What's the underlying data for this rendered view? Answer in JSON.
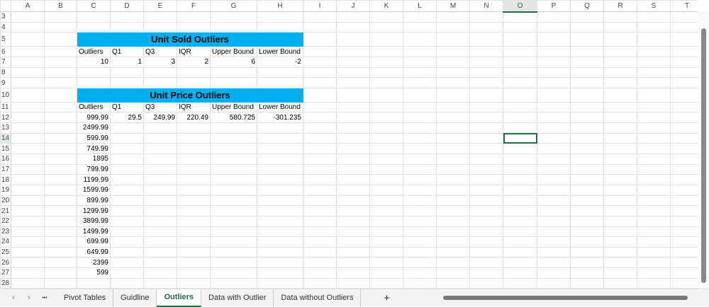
{
  "columns": [
    "A",
    "B",
    "C",
    "D",
    "E",
    "F",
    "G",
    "H",
    "I",
    "J",
    "K",
    "L",
    "M",
    "N",
    "O",
    "P",
    "Q",
    "R",
    "S",
    "T"
  ],
  "selected_cell": "O14",
  "unit_sold": {
    "title": "Unit Sold Outliers",
    "headers": [
      "Outliers",
      "Q1",
      "Q3",
      "IQR",
      "Upper Bound",
      "Lower Bound"
    ],
    "values": [
      "10",
      "1",
      "3",
      "2",
      "6",
      "-2"
    ]
  },
  "unit_price": {
    "title": "Unit Price Outliers",
    "headers": [
      "Outliers",
      "Q1",
      "Q3",
      "IQR",
      "Upper Bound",
      "Lower Bound"
    ],
    "values": [
      "999.99",
      "29.5",
      "249.99",
      "220.49",
      "580.725",
      "-301.235"
    ],
    "outliers": [
      "2499.99",
      "599.99",
      "749.99",
      "1895",
      "799.99",
      "1199.99",
      "1599.99",
      "899.99",
      "1299.99",
      "3899.99",
      "1499.99",
      "699.99",
      "649.99",
      "2399",
      "599"
    ]
  },
  "tabs": [
    "Pivot Tables",
    "Guidline",
    "Outliers",
    "Data with Outlier",
    "Data without Outliers"
  ],
  "active_tab": "Outliers",
  "icons": {
    "prev": "‹",
    "next": "›",
    "more": "•••",
    "add": "+"
  },
  "accent": "#00b0f0"
}
